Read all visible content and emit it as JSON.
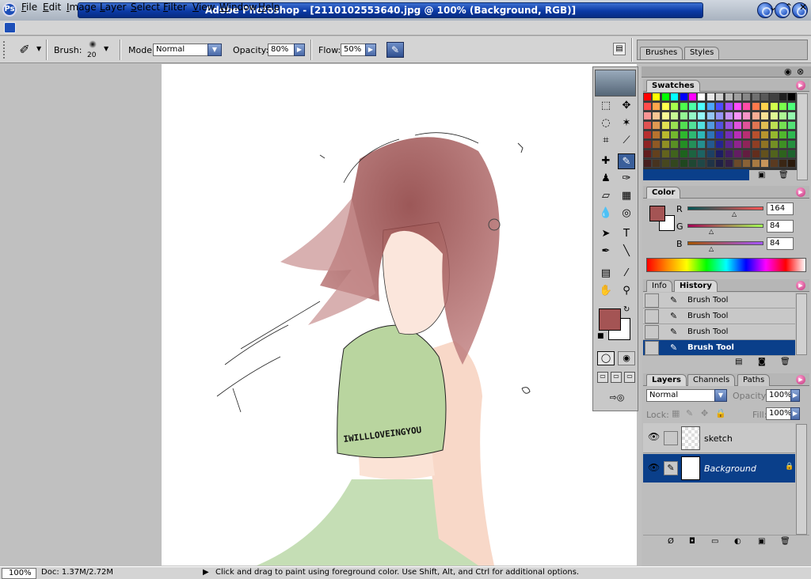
{
  "window": {
    "title": "Adobe Photoshop - [2110102553640.jpg @ 100% (Background, RGB)]",
    "logo": "Ps"
  },
  "menus": [
    "File",
    "Edit",
    "Image",
    "Layer",
    "Select",
    "Filter",
    "View",
    "Window",
    "Help"
  ],
  "options": {
    "brush_label": "Brush:",
    "brush_size": "20",
    "mode_label": "Mode:",
    "mode_value": "Normal",
    "opacity_label": "Opacity:",
    "opacity_value": "80%",
    "flow_label": "Flow:",
    "flow_value": "50%"
  },
  "palette_well": {
    "tabs": [
      "Brushes",
      "Styles"
    ]
  },
  "swatches": {
    "tab": "Swatches"
  },
  "color_panel": {
    "tab": "Color",
    "r_label": "R",
    "g_label": "G",
    "b_label": "B",
    "r": "164",
    "g": "84",
    "b": "84",
    "foreground": "#a45454",
    "background": "#ffffff"
  },
  "history": {
    "tabs": [
      "Info",
      "History"
    ],
    "items": [
      "Brush Tool",
      "Brush Tool",
      "Brush Tool",
      "Brush Tool"
    ],
    "selected": 3
  },
  "layers": {
    "tabs": [
      "Layers",
      "Channels",
      "Paths"
    ],
    "blend_mode": "Normal",
    "opacity_label": "Opacity:",
    "opacity_value": "100%",
    "lock_label": "Lock:",
    "fill_label": "Fill:",
    "fill_value": "100%",
    "items": [
      {
        "name": "sketch"
      },
      {
        "name": "Background"
      }
    ]
  },
  "canvas": {
    "shirt_text": "IWILLLOVEINGYOU"
  },
  "status": {
    "zoom": "100%",
    "doc": "Doc: 1.37M/2.72M",
    "hint": "Click and drag to paint using foreground color.  Use Shift, Alt, and Ctrl for additional options."
  }
}
